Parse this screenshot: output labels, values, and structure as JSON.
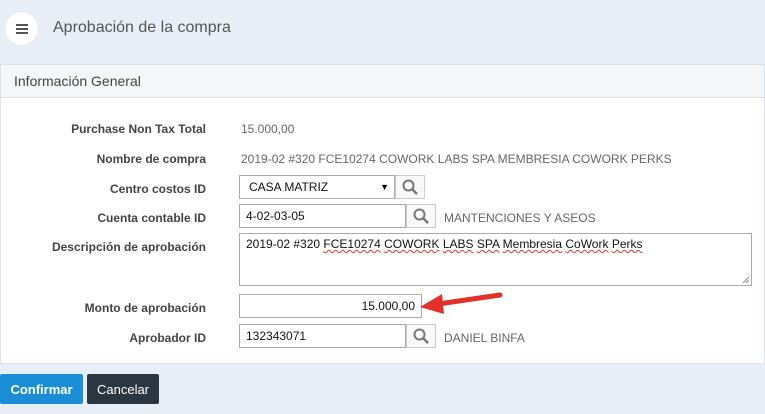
{
  "header": {
    "title": "Aprobación de la compra"
  },
  "section": {
    "title": "Información General"
  },
  "fields": {
    "purchase_non_tax_total": {
      "label": "Purchase Non Tax Total",
      "value": "15.000,00"
    },
    "nombre_compra": {
      "label": "Nombre de compra",
      "value": "2019-02 #320 FCE10274 COWORK LABS SPA MEMBRESIA COWORK PERKS"
    },
    "centro_costos": {
      "label": "Centro costos ID",
      "value": "CASA MATRIZ"
    },
    "cuenta_contable": {
      "label": "Cuenta contable ID",
      "value": "4-02-03-05",
      "description": "MANTENCIONES Y ASEOS"
    },
    "descripcion": {
      "label": "Descripción de aprobación",
      "words": [
        "2019-02 #320 ",
        "FCE10274",
        " ",
        "COWORK",
        " ",
        "LABS",
        " ",
        "SPA",
        " ",
        "Membresia",
        " ",
        "CoWork",
        " ",
        "Perks"
      ]
    },
    "monto": {
      "label": "Monto de aprobación",
      "value": "15.000,00"
    },
    "aprobador": {
      "label": "Aprobador ID",
      "value": "132343071",
      "description": "DANIEL BINFA"
    }
  },
  "buttons": {
    "confirm": "Confirmar",
    "cancel": "Cancelar"
  },
  "icons": {
    "menu": "hamburger-icon",
    "search": "search-icon",
    "annotation": "red-arrow-icon"
  },
  "colors": {
    "primary": "#1a8dd6",
    "dark": "#2c3641",
    "arrow": "#e0322b"
  }
}
